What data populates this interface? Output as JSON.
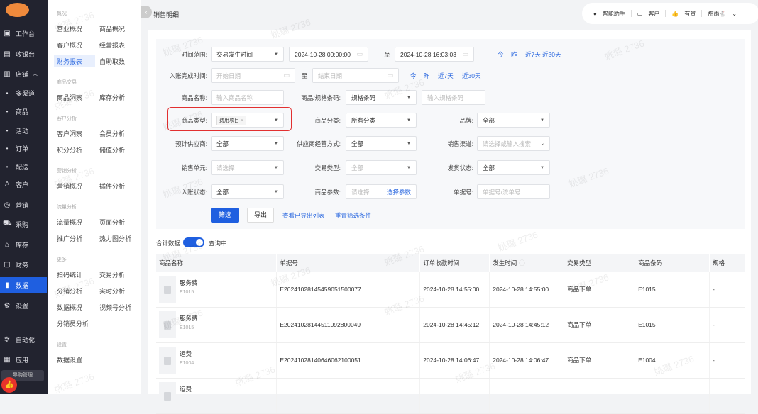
{
  "nav": {
    "items": [
      {
        "label": "工作台",
        "icon": "desk-icon"
      },
      {
        "label": "收银台",
        "icon": "cashier-icon"
      },
      {
        "label": "店铺",
        "icon": "store-icon",
        "expanded": true
      },
      {
        "label": "多渠道",
        "sub": true
      },
      {
        "label": "商品",
        "sub": true
      },
      {
        "label": "活动",
        "sub": true
      },
      {
        "label": "订单",
        "sub": true
      },
      {
        "label": "配送",
        "sub": true
      },
      {
        "label": "客户",
        "icon": "user-icon"
      },
      {
        "label": "营销",
        "icon": "marketing-icon"
      },
      {
        "label": "采购",
        "icon": "cart-icon"
      },
      {
        "label": "库存",
        "icon": "warehouse-icon"
      },
      {
        "label": "财务",
        "icon": "finance-icon"
      },
      {
        "label": "数据",
        "icon": "chart-icon",
        "active": true
      },
      {
        "label": "设置",
        "icon": "gear-icon"
      },
      {
        "label": "自动化",
        "icon": "automation-icon"
      },
      {
        "label": "应用",
        "icon": "apps-icon"
      }
    ],
    "guide": "导购管理"
  },
  "menu": {
    "sections": [
      {
        "title": "概况",
        "items": [
          "营业概况",
          "商品概况",
          "客户概况",
          "经营报表",
          "财务报表",
          "自助取数"
        ]
      },
      {
        "title": "商品交易",
        "items": [
          "商品洞察",
          "库存分析"
        ]
      },
      {
        "title": "客户分析",
        "items": [
          "客户洞察",
          "会员分析",
          "积分分析",
          "储值分析"
        ]
      },
      {
        "title": "营销分析",
        "items": [
          "营销概况",
          "插件分析"
        ]
      },
      {
        "title": "流量分析",
        "items": [
          "流量概况",
          "页面分析",
          "推广分析",
          "热力图分析"
        ]
      },
      {
        "title": "更多",
        "items": [
          "扫码统计",
          "交易分析",
          "分销分析",
          "实时分析",
          "数据概况",
          "视频号分析",
          "分销员分析"
        ]
      },
      {
        "title": "设置",
        "items": [
          "数据设置"
        ]
      }
    ],
    "active": "财务报表"
  },
  "header": {
    "title": "销售明细",
    "assistant": "智能助手",
    "customer": "客户",
    "youzan": "有赞",
    "user": "甜雨🐇"
  },
  "filters": {
    "time_range_label": "时间范围:",
    "time_type": "交易发生时间",
    "start": "2024-10-28 00:00:00",
    "to": "至",
    "end": "2024-10-28 16:03:03",
    "quick": [
      "今",
      "昨",
      "近7天",
      "近30天"
    ],
    "settle_label": "入账完成时间:",
    "settle_start_ph": "开始日期",
    "settle_end_ph": "结束日期",
    "name_label": "商品名称:",
    "name_ph": "输入商品名称",
    "code_label": "商品/规格条码:",
    "code_type": "规格条码",
    "code_ph": "输入规格条码",
    "type_label": "商品类型:",
    "type_tag": "费用项目",
    "cat_label": "商品分类:",
    "cat_value": "所有分类",
    "brand_label": "品牌:",
    "brand_value": "全部",
    "supplier_label": "预计供应商:",
    "supplier_value": "全部",
    "mode_label": "供应商经营方式:",
    "mode_value": "全部",
    "channel_label": "销售渠道:",
    "channel_ph": "请选择或输入搜索",
    "unit_label": "销售单元:",
    "unit_ph": "请选择",
    "trade_label": "交易类型:",
    "trade_ph": "全部",
    "ship_label": "发货状态:",
    "ship_value": "全部",
    "settle_status_label": "入账状态:",
    "settle_status_value": "全部",
    "param_label": "商品参数:",
    "param_ph": "请选择",
    "param_link": "选择参数",
    "bill_label": "单据号:",
    "bill_ph": "单据号/流单号",
    "filter_btn": "筛选",
    "export_btn": "导出",
    "view_exports": "查看已导出列表",
    "reset": "重置筛选条件"
  },
  "summary": {
    "label": "合计数据",
    "status": "查询中...",
    "toggle_on": true
  },
  "table": {
    "headers": [
      "商品名称",
      "单据号",
      "订单收款时间",
      "发生时间",
      "交易类型",
      "商品条码",
      "规格"
    ],
    "rows": [
      {
        "name": "服务费",
        "code": "E1015",
        "bill": "E202410281454590515000​77",
        "pay": "2024-10-28 14:55:00",
        "occur": "2024-10-28 14:55:00",
        "type": "商品下单",
        "barcode": "E1015",
        "spec": "-"
      },
      {
        "name": "服务费",
        "code": "E1015",
        "bill": "E20241028144511092800049",
        "pay": "2024-10-28 14:45:12",
        "occur": "2024-10-28 14:45:12",
        "type": "商品下单",
        "barcode": "E1015",
        "spec": "-"
      },
      {
        "name": "运费",
        "code": "E1004",
        "bill": "E20241028140646062100051",
        "pay": "2024-10-28 14:06:47",
        "occur": "2024-10-28 14:06:47",
        "type": "商品下单",
        "barcode": "E1004",
        "spec": "-"
      },
      {
        "name": "运费",
        "code": "",
        "bill": "",
        "pay": "",
        "occur": "",
        "type": "",
        "barcode": "",
        "spec": ""
      }
    ]
  },
  "watermark": "姚璐 2736"
}
